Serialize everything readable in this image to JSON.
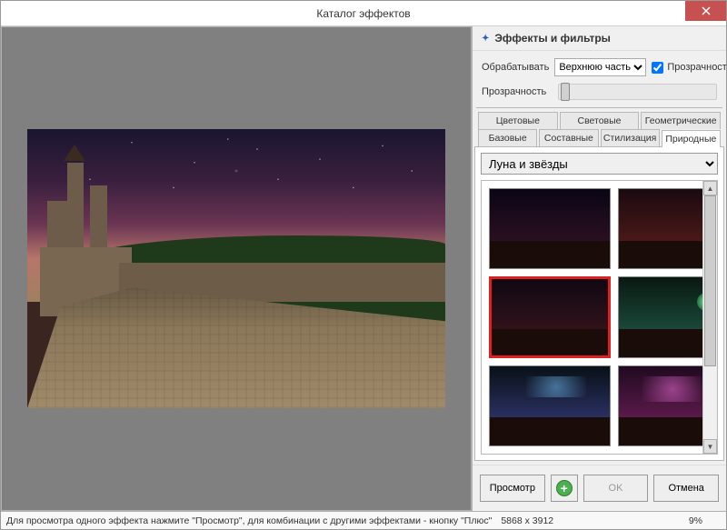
{
  "window": {
    "title": "Каталог эффектов"
  },
  "panel": {
    "header": "Эффекты и фильтры",
    "process_label": "Обрабатывать",
    "process_options": [
      "Верхнюю часть"
    ],
    "process_selected": "Верхнюю часть",
    "transparency_check": "Прозрачность",
    "transparency_checked": true,
    "transparency_label": "Прозрачность"
  },
  "tabs": {
    "row1": [
      {
        "label": "Цветовые",
        "active": false
      },
      {
        "label": "Световые",
        "active": false
      },
      {
        "label": "Геометрические",
        "active": false
      }
    ],
    "row2": [
      {
        "label": "Базовые",
        "active": false
      },
      {
        "label": "Составные",
        "active": false
      },
      {
        "label": "Стилизация",
        "active": false
      },
      {
        "label": "Природные",
        "active": true
      }
    ]
  },
  "effect": {
    "selected": "Луна и звёзды",
    "thumbs_selected_index": 2
  },
  "buttons": {
    "preview": "Просмотр",
    "ok": "OK",
    "cancel": "Отмена"
  },
  "status": {
    "hint": "Для просмотра одного эффекта нажмите \"Просмотр\", для комбинации с другими эффектами - кнопку \"Плюс\"",
    "dimensions": "5868 x 3912",
    "percent": "9%"
  }
}
